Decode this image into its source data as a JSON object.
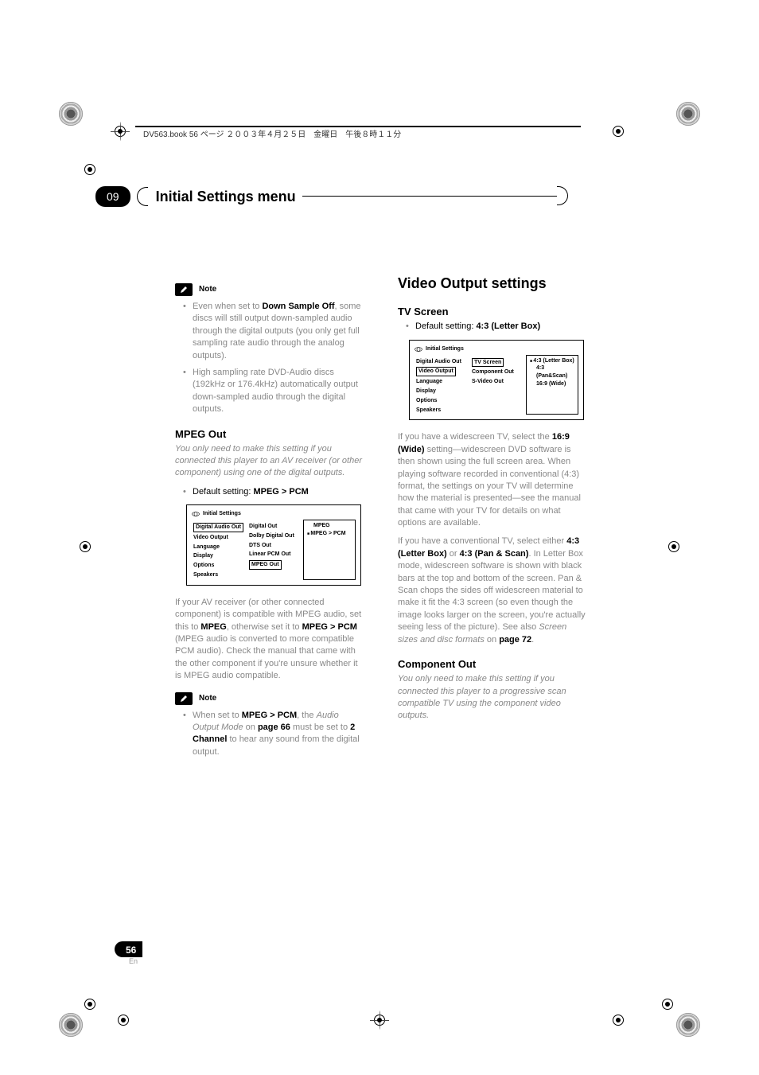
{
  "header_text": "DV563.book  56 ページ  ２００３年４月２５日　金曜日　午後８時１１分",
  "chapter": {
    "number": "09",
    "title": "Initial Settings menu"
  },
  "left_column": {
    "note_label": "Note",
    "note1_bullets": [
      {
        "prefix": "Even when set to ",
        "bold": "Down Sample Off",
        "suffix": ", some discs will still output down-sampled audio through the digital outputs (you only get full sampling rate audio through the analog outputs)."
      },
      {
        "text": "High sampling rate DVD-Audio discs (192kHz or 176.4kHz) automatically output down-sampled audio through the digital outputs."
      }
    ],
    "mpeg_heading": "MPEG Out",
    "mpeg_intro": "You only need to make this setting if you connected this player to an AV receiver (or other component) using one of the digital outputs.",
    "mpeg_default_label": "Default setting: ",
    "mpeg_default_value": "MPEG > PCM",
    "menu1": {
      "title": "Initial Settings",
      "col1": [
        "Digital Audio Out",
        "Video Output",
        "Language",
        "Display",
        "Options",
        "Speakers"
      ],
      "col2": [
        "Digital Out",
        "Dolby Digital Out",
        "DTS Out",
        "Linear PCM Out",
        "MPEG Out"
      ],
      "col3": [
        "MPEG",
        "MPEG > PCM"
      ]
    },
    "mpeg_body_1a": "If your AV receiver (or other connected component) is compatible with MPEG audio, set this to ",
    "mpeg_body_1b": "MPEG",
    "mpeg_body_1c": ", otherwise set it to ",
    "mpeg_body_1d": "MPEG > PCM",
    "mpeg_body_1e": " (MPEG audio is converted to more compatible PCM audio). Check the manual that came with the other component if you're unsure whether it is MPEG audio compatible.",
    "note2_label": "Note",
    "note2_a": "When set to ",
    "note2_b": "MPEG > PCM",
    "note2_c": ", the ",
    "note2_d": "Audio Output Mode",
    "note2_e": " on ",
    "note2_f": "page 66",
    "note2_g": " must be set to ",
    "note2_h": "2 Channel",
    "note2_i": " to hear any sound from the digital output."
  },
  "right_column": {
    "main_heading": "Video Output settings",
    "tv_heading": "TV Screen",
    "tv_default_label": "Default setting: ",
    "tv_default_value": "4:3 (Letter Box)",
    "menu2": {
      "title": "Initial Settings",
      "col1": [
        "Digital Audio Out",
        "Video Output",
        "Language",
        "Display",
        "Options",
        "Speakers"
      ],
      "col2": [
        "TV Screen",
        "Component Out",
        "S-Video Out"
      ],
      "col3": [
        "4:3 (Letter Box)",
        "4:3 (Pan&Scan)",
        "16:9 (Wide)"
      ]
    },
    "tv_para1_a": "If you have a widescreen TV, select the ",
    "tv_para1_b": "16:9 (Wide)",
    "tv_para1_c": " setting—widescreen DVD software is then shown using the full screen area. When playing software recorded in conventional (4:3) format, the settings on your TV will determine how the material is presented—see the manual that came with your TV for details on what options are available.",
    "tv_para2_a": "If you have a conventional TV, select either ",
    "tv_para2_b": "4:3 (Letter Box)",
    "tv_para2_c": " or ",
    "tv_para2_d": "4:3 (Pan & Scan)",
    "tv_para2_e": ". In Letter Box mode, widescreen software is shown with black bars at the top and bottom of the screen. Pan & Scan chops the sides off widescreen material to make it fit the 4:3 screen (so even though the image looks larger on the screen, you're actually seeing less of the picture). See also ",
    "tv_para2_f": "Screen sizes and disc formats",
    "tv_para2_g": " on ",
    "tv_para2_h": "page 72",
    "tv_para2_i": ".",
    "comp_heading": "Component Out",
    "comp_intro": "You only need to make this setting if you connected this player to a progressive scan compatible TV using the component video outputs."
  },
  "page_number": "56",
  "page_lang": "En"
}
